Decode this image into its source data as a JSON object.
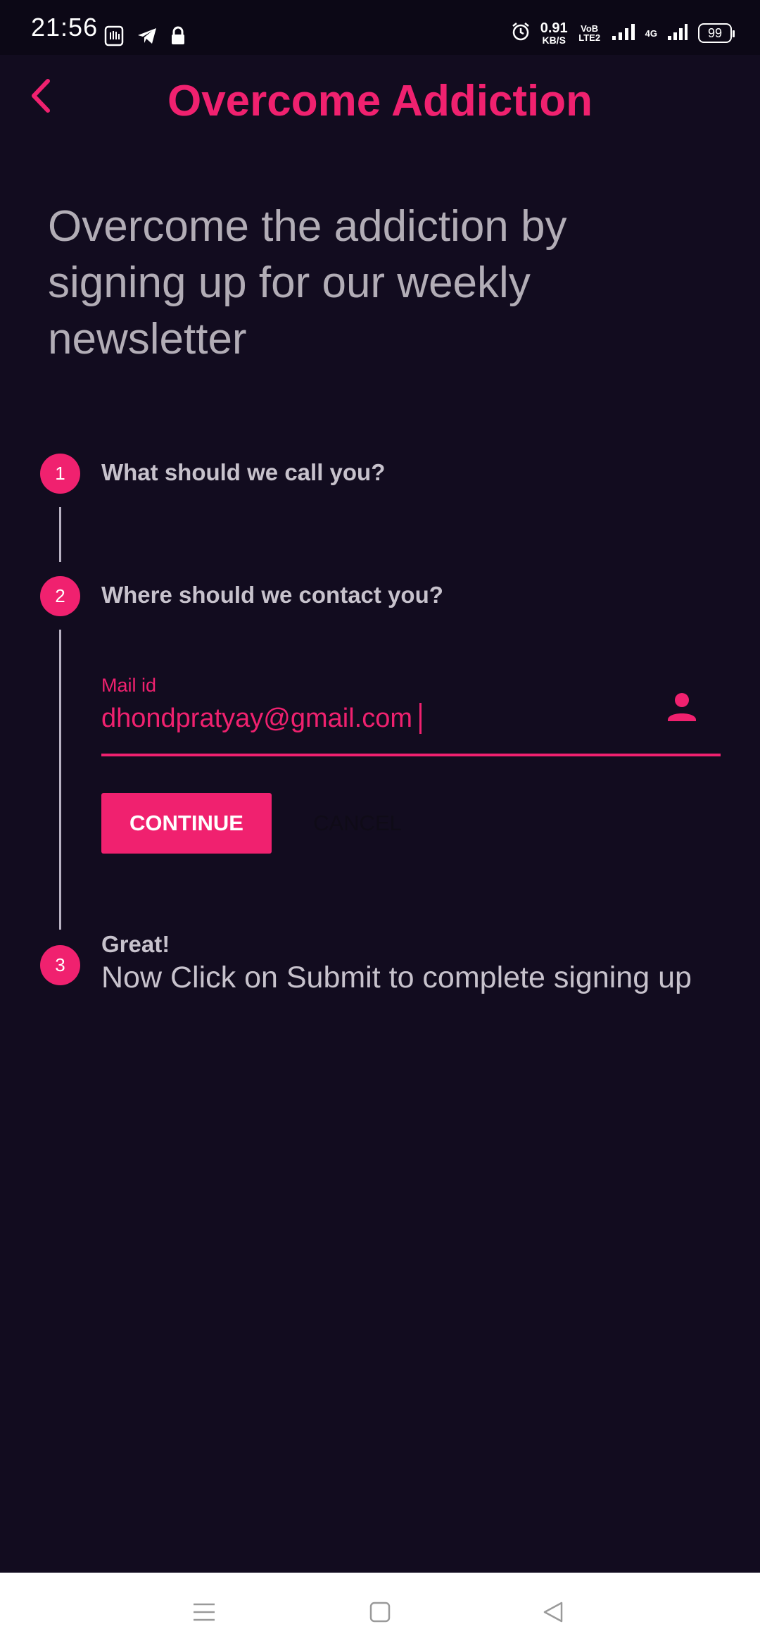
{
  "status_bar": {
    "time": "21:56",
    "net_speed_value": "0.91",
    "net_speed_unit": "KB/S",
    "volte_label": "VoB LTE2",
    "net_type": "4G",
    "battery": "99",
    "left_icons": [
      "hand-icon",
      "telegram-icon",
      "lock-icon"
    ],
    "right_icons": [
      "alarm-icon",
      "signal-icon",
      "signal-icon"
    ]
  },
  "app_bar": {
    "title": "Overcome Addiction",
    "back_icon": "chevron-left-icon"
  },
  "headline": "Overcome the addiction by signing up for our weekly newsletter",
  "steps": [
    {
      "number": "1",
      "title": "What should we call you?"
    },
    {
      "number": "2",
      "title": "Where should we contact you?"
    },
    {
      "number": "3",
      "title": "Great!",
      "subtitle": "Now Click on Submit to complete signing up"
    }
  ],
  "email_field": {
    "label": "Mail id",
    "value": "dhondpratyay@gmail.com",
    "icon": "person-icon"
  },
  "buttons": {
    "continue": "CONTINUE",
    "cancel": "CANCEL"
  },
  "nav_bar": {
    "icons": [
      "menu-icon",
      "home-square-icon",
      "back-triangle-icon"
    ]
  },
  "colors": {
    "background": "#120c1f",
    "accent": "#f0216f",
    "text_muted": "#b2adb6",
    "nav_background": "#ffffff"
  }
}
